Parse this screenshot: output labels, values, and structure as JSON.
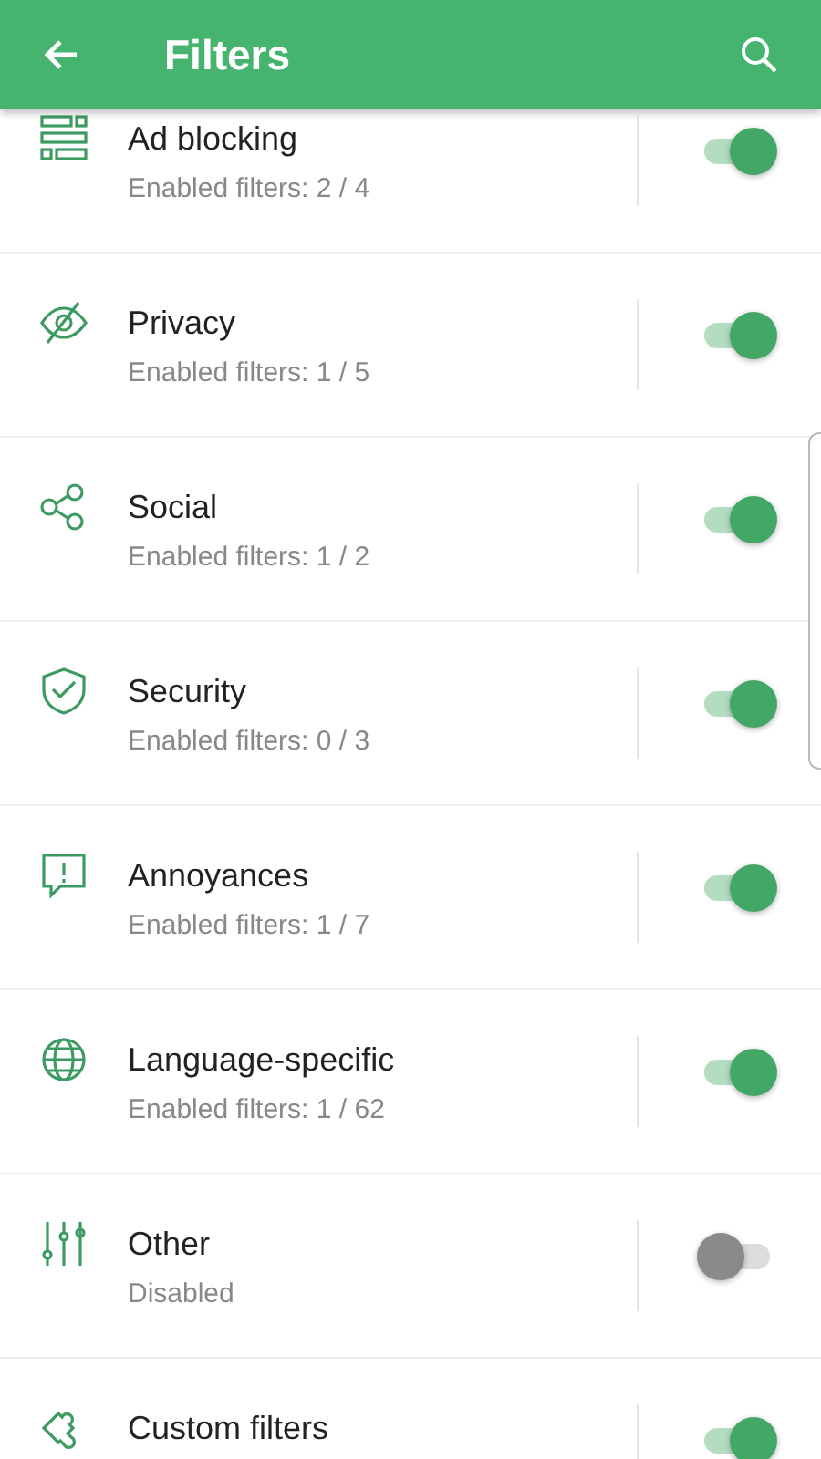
{
  "toolbar": {
    "title": "Filters"
  },
  "categories": [
    {
      "name": "Ad blocking",
      "status": "Enabled filters: 2 / 4",
      "on": true
    },
    {
      "name": "Privacy",
      "status": "Enabled filters: 1 / 5",
      "on": true
    },
    {
      "name": "Social",
      "status": "Enabled filters: 1 / 2",
      "on": true
    },
    {
      "name": "Security",
      "status": "Enabled filters: 0 / 3",
      "on": true
    },
    {
      "name": "Annoyances",
      "status": "Enabled filters: 1 / 7",
      "on": true
    },
    {
      "name": "Language-specific",
      "status": "Enabled filters: 1 / 62",
      "on": true
    },
    {
      "name": "Other",
      "status": "Disabled",
      "on": false
    },
    {
      "name": "Custom filters",
      "on": true
    }
  ]
}
